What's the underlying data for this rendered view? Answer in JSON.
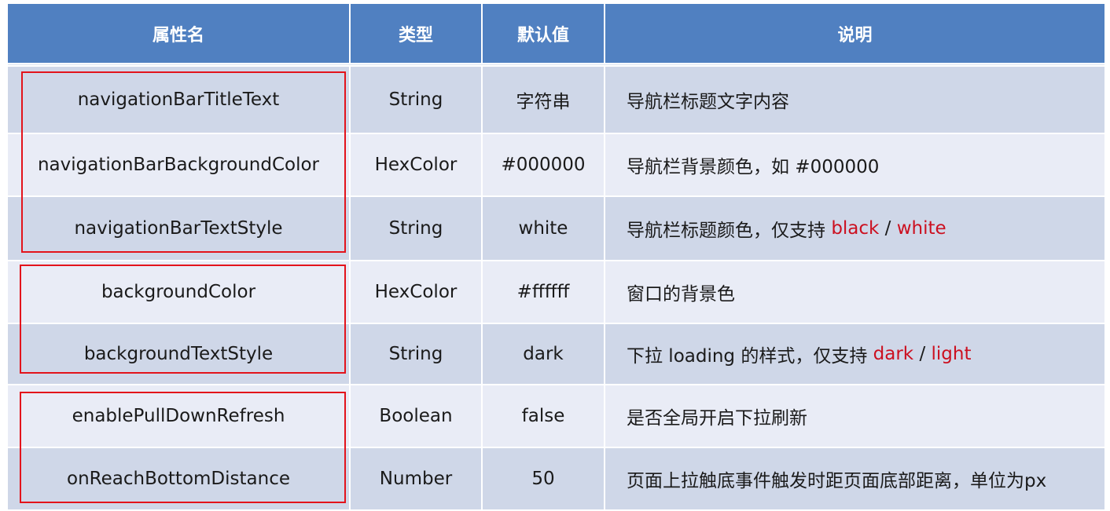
{
  "table": {
    "headers": [
      "属性名",
      "类型",
      "默认值",
      "说明"
    ],
    "rows": [
      {
        "name": "navigationBarTitleText",
        "type": "String",
        "default": "字符串",
        "desc_prefix": "导航栏标题文字内容",
        "opt1": "",
        "sep": "",
        "opt2": ""
      },
      {
        "name": "navigationBarBackgroundColor",
        "type": "HexColor",
        "default": "#000000",
        "desc_prefix": "导航栏背景颜色，如 #000000",
        "opt1": "",
        "sep": "",
        "opt2": ""
      },
      {
        "name": "navigationBarTextStyle",
        "type": "String",
        "default": "white",
        "desc_prefix": "导航栏标题颜色，仅支持 ",
        "opt1": "black",
        "sep": " / ",
        "opt2": "white"
      },
      {
        "name": "backgroundColor",
        "type": "HexColor",
        "default": "#ffffff",
        "desc_prefix": "窗口的背景色",
        "opt1": "",
        "sep": "",
        "opt2": ""
      },
      {
        "name": "backgroundTextStyle",
        "type": "String",
        "default": "dark",
        "desc_prefix": "下拉 loading 的样式，仅支持 ",
        "opt1": "dark",
        "sep": " / ",
        "opt2": "light"
      },
      {
        "name": "enablePullDownRefresh",
        "type": "Boolean",
        "default": "false",
        "desc_prefix": "是否全局开启下拉刷新",
        "opt1": "",
        "sep": "",
        "opt2": ""
      },
      {
        "name": "onReachBottomDistance",
        "type": "Number",
        "default": "50",
        "desc_prefix": "页面上拉触底事件触发时距页面底部距离，单位为px",
        "opt1": "",
        "sep": "",
        "opt2": ""
      }
    ]
  },
  "highlight_groups": [
    {
      "label": "navigation-bar-group",
      "rows": [
        0,
        1,
        2
      ]
    },
    {
      "label": "background-group",
      "rows": [
        3,
        4
      ]
    },
    {
      "label": "pull-refresh-group",
      "rows": [
        5,
        6
      ]
    }
  ],
  "colors": {
    "header_bg": "#5080c1",
    "row_dark": "#cfd7e8",
    "row_light": "#e9ecf6",
    "highlight_text": "#cc1020",
    "highlight_box": "#e3131b"
  }
}
